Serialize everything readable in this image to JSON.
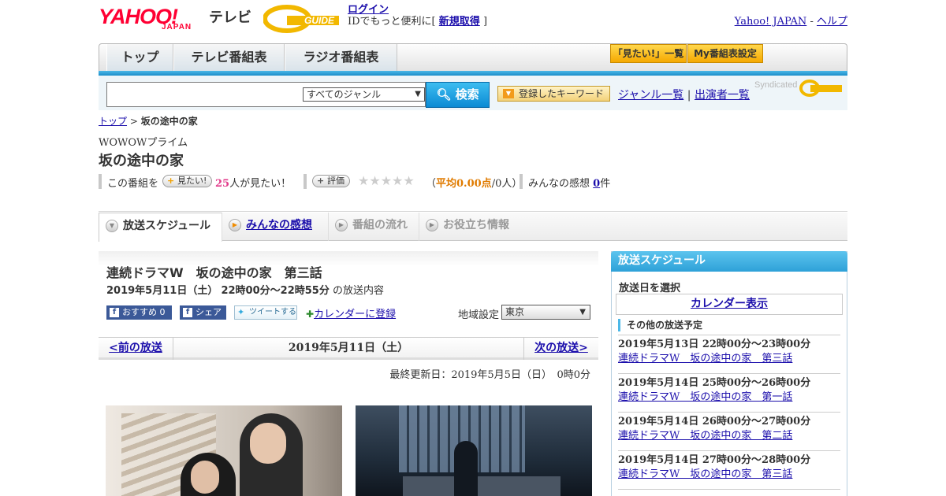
{
  "header": {
    "brand_yahoo": "YAHOO!",
    "brand_japan": "JAPAN",
    "brand_tv": "テレビ",
    "brand_gguide": "G-GUIDE",
    "login_link": "ログイン",
    "login_prefix": "IDでもっと便利に[",
    "signup_link": "新規取得",
    "login_suffix": "]",
    "yahoo_japan_link": "Yahoo! JAPAN",
    "help_sep": "-",
    "help_link": "ヘルプ"
  },
  "nav": {
    "tabs": [
      {
        "label": "トップ"
      },
      {
        "label": "テレビ番組表"
      },
      {
        "label": "ラジオ番組表"
      }
    ],
    "mitai_list": "「見たい!」一覧",
    "my_schedule": "My番組表設定"
  },
  "search": {
    "placeholder": "",
    "genre_selected": "すべてのジャンル",
    "search_button": "検索",
    "keyword_button": "登録したキーワード",
    "genre_list_link": "ジャンル一覧",
    "link_sep": "|",
    "performer_list_link": "出演者一覧",
    "syndicated": "Syndicated",
    "syndicated_brand": "G-GUIDE"
  },
  "breadcrumb": {
    "top": "トップ",
    "sep": ">",
    "current": "坂の途中の家"
  },
  "program": {
    "channel": "WOWOWプライム",
    "title": "坂の途中の家",
    "mitai_prefix": "この番組を",
    "mitai_button": "見たい!",
    "mitai_count": "25",
    "mitai_suffix": "人が見たい！",
    "rating_button": "評価",
    "stars": "★★★★★",
    "rating_open": "（",
    "rating_avg": "平均0.00点",
    "rating_count": "/0人）",
    "impressions_label": "みんなの感想",
    "impressions_count": "0",
    "impressions_unit": "件"
  },
  "tabs": [
    {
      "label": "放送スケジュール"
    },
    {
      "label": "みんなの感想"
    },
    {
      "label": "番組の流れ"
    },
    {
      "label": "お役立ち情報"
    }
  ],
  "episode": {
    "title": "連続ドラマW　坂の途中の家　第三話",
    "date_time": "2019年5月11日（土）",
    "time_range": "22時00分～22時55分",
    "date_suffix": "の放送内容",
    "share_recommend": "おすすめ",
    "share_recommend_count": "0",
    "share_fb": "シェア",
    "share_tweet": "ツイートする",
    "calendar_register": "カレンダーに登録",
    "region_label": "地域設定",
    "region_selected": "東京",
    "prev": "<前の放送",
    "current_date": "2019年5月11日（土）",
    "next": "次の放送>",
    "updated": "最終更新日：2019年5月5日（日）　0時0分"
  },
  "sidebar": {
    "heading": "放送スケジュール",
    "select_date": "放送日を選択",
    "calendar_link": "カレンダー表示",
    "other_heading": "その他の放送予定",
    "items": [
      {
        "when": "2019年5月13日  22時00分～23時00分",
        "what": "連続ドラマW　坂の途中の家　第三話"
      },
      {
        "when": "2019年5月14日  25時00分～26時00分",
        "what": "連続ドラマW　坂の途中の家　第一話"
      },
      {
        "when": "2019年5月14日  26時00分～27時00分",
        "what": "連続ドラマW　坂の途中の家　第二話"
      },
      {
        "when": "2019年5月14日  27時00分～28時00分",
        "what": "連続ドラマW　坂の途中の家　第三話"
      }
    ]
  },
  "colors": {
    "yahoo_red": "#ff0033",
    "accent_blue": "#2ea1d8",
    "link": "#1a0dab",
    "orange": "#f5a800"
  }
}
